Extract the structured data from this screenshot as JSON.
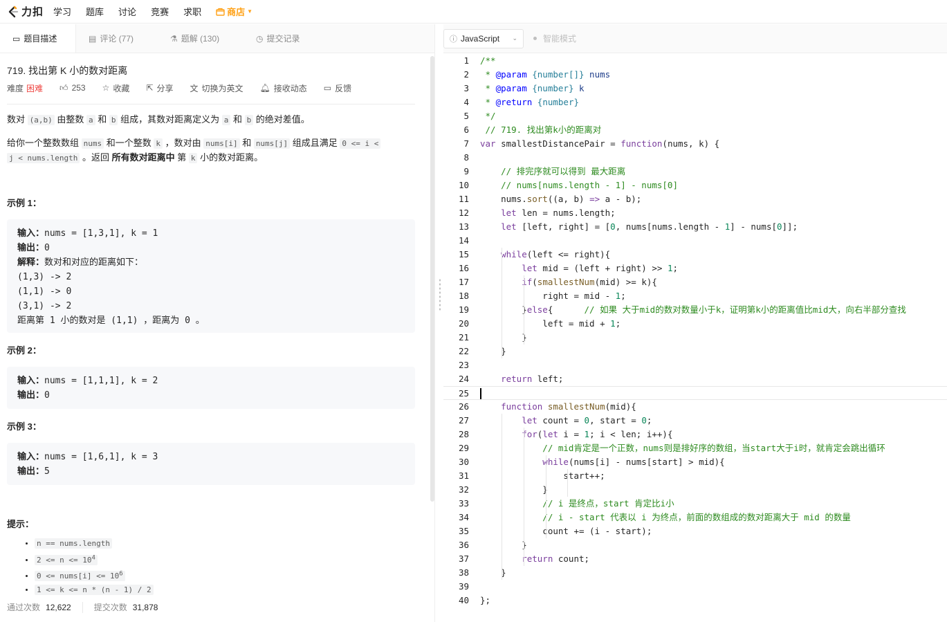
{
  "nav": {
    "logo_text": "力扣",
    "items": [
      "学习",
      "题库",
      "讨论",
      "竞赛",
      "求职"
    ],
    "store_label": "商店"
  },
  "tabs": [
    {
      "label": "题目描述",
      "icon": "description-icon"
    },
    {
      "label": "评论 (77)",
      "icon": "comment-icon"
    },
    {
      "label": "题解 (130)",
      "icon": "flask-icon"
    },
    {
      "label": "提交记录",
      "icon": "clock-icon"
    }
  ],
  "problem": {
    "title": "719. 找出第 K 小的数对距离",
    "difficulty_label": "难度",
    "difficulty": "困难",
    "likes": "253",
    "favorite": "收藏",
    "share": "分享",
    "switch_lang": "切换为英文",
    "subscribe": "接收动态",
    "feedback": "反馈",
    "p1_a": "数对 ",
    "p1_code1": "(a,b)",
    "p1_b": " 由整数 ",
    "p1_code2": "a",
    "p1_c": " 和 ",
    "p1_code3": "b",
    "p1_d": " 组成，其数对距离定义为 ",
    "p1_code4": "a",
    "p1_e": " 和 ",
    "p1_code5": "b",
    "p1_f": " 的绝对差值。",
    "p2_a": "给你一个整数数组 ",
    "p2_code1": "nums",
    "p2_b": " 和一个整数 ",
    "p2_code2": "k",
    "p2_c": " ，数对由 ",
    "p2_code3": "nums[i]",
    "p2_d": " 和 ",
    "p2_code4": "nums[j]",
    "p2_e": " 组成且满足 ",
    "p2_code5": "0 <= i <",
    "p2_code6": "j < nums.length",
    "p2_f": " 。返回 ",
    "p2_bold": "所有数对距离中",
    "p2_g": " 第 ",
    "p2_code7": "k",
    "p2_h": " 小的数对距离。"
  },
  "examples": [
    {
      "title": "示例 1：",
      "lines": [
        {
          "label": "输入：",
          "text": "nums = [1,3,1], k = 1"
        },
        {
          "label": "输出：",
          "text": "0"
        },
        {
          "label": "解释：",
          "text": "数对和对应的距离如下："
        },
        {
          "label": "",
          "text": "(1,3) -> 2"
        },
        {
          "label": "",
          "text": "(1,1) -> 0"
        },
        {
          "label": "",
          "text": "(3,1) -> 2"
        },
        {
          "label": "",
          "text": "距离第 1 小的数对是 (1,1) ，距离为 0 。"
        }
      ]
    },
    {
      "title": "示例 2：",
      "lines": [
        {
          "label": "输入：",
          "text": "nums = [1,1,1], k = 2"
        },
        {
          "label": "输出：",
          "text": "0"
        }
      ]
    },
    {
      "title": "示例 3：",
      "lines": [
        {
          "label": "输入：",
          "text": "nums = [1,6,1], k = 3"
        },
        {
          "label": "输出：",
          "text": "5"
        }
      ]
    }
  ],
  "tips": {
    "title": "提示：",
    "items": [
      {
        "base": "n == nums.length",
        "sup": ""
      },
      {
        "base": "2 <= n <= 10",
        "sup": "4"
      },
      {
        "base": "0 <= nums[i] <= 10",
        "sup": "6"
      },
      {
        "base": "1 <= k <= n * (n - 1) / 2",
        "sup": ""
      }
    ]
  },
  "stats": {
    "accepted_label": "通过次数",
    "accepted": "12,622",
    "submitted_label": "提交次数",
    "submitted": "31,878"
  },
  "editor": {
    "language": "JavaScript",
    "smart_mode": "智能模式",
    "current_line": 25,
    "lines": [
      [
        [
          "cm",
          "/**"
        ]
      ],
      [
        [
          "cm",
          " * "
        ],
        [
          "jd",
          "@param"
        ],
        [
          "jt",
          " {number[]}"
        ],
        [
          "pr",
          " nums"
        ]
      ],
      [
        [
          "cm",
          " * "
        ],
        [
          "jd",
          "@param"
        ],
        [
          "jt",
          " {number}"
        ],
        [
          "pr",
          " k"
        ]
      ],
      [
        [
          "cm",
          " * "
        ],
        [
          "jd",
          "@return"
        ],
        [
          "jt",
          " {number}"
        ]
      ],
      [
        [
          "cm",
          " */"
        ]
      ],
      [
        [
          "cm",
          " // 719. 找出第k小的距离对"
        ]
      ],
      [
        [
          "kw",
          "var"
        ],
        [
          "",
          " smallestDistancePair = "
        ],
        [
          "kw",
          "function"
        ],
        [
          "",
          "(nums, k) {"
        ]
      ],
      [
        [
          "",
          ""
        ]
      ],
      [
        [
          "cm",
          "    // 排完序就可以得到 最大距离"
        ]
      ],
      [
        [
          "cm",
          "    // nums[nums.length - 1] - nums[0]"
        ]
      ],
      [
        [
          "",
          "    nums."
        ],
        [
          "fn",
          "sort"
        ],
        [
          "",
          "((a, b) "
        ],
        [
          "kw",
          "=>"
        ],
        [
          "",
          " a - b);"
        ]
      ],
      [
        [
          "kw",
          "    let"
        ],
        [
          "",
          " len = nums.length;"
        ]
      ],
      [
        [
          "kw",
          "    let"
        ],
        [
          "",
          " [left, right] = ["
        ],
        [
          "num",
          "0"
        ],
        [
          "",
          ", nums[nums.length - "
        ],
        [
          "num",
          "1"
        ],
        [
          "",
          "] - nums["
        ],
        [
          "num",
          "0"
        ],
        [
          "",
          "]];"
        ]
      ],
      [
        [
          "",
          ""
        ]
      ],
      [
        [
          "kw",
          "    while"
        ],
        [
          "",
          "(left <= right){"
        ]
      ],
      [
        [
          "kw",
          "        let"
        ],
        [
          "",
          " mid = (left + right) >> "
        ],
        [
          "num",
          "1"
        ],
        [
          "",
          ";"
        ]
      ],
      [
        [
          "kw",
          "        if"
        ],
        [
          "",
          "("
        ],
        [
          "fn",
          "smallestNum"
        ],
        [
          "",
          "(mid) >= k){"
        ]
      ],
      [
        [
          "",
          "            right = mid - "
        ],
        [
          "num",
          "1"
        ],
        [
          "",
          ";"
        ]
      ],
      [
        [
          "",
          "        }"
        ],
        [
          "kw",
          "else"
        ],
        [
          "",
          "{      "
        ],
        [
          "cm",
          "// 如果 大于mid的数对数量小于k，证明第k小的距离值比mid大，向右半部分查找"
        ]
      ],
      [
        [
          "",
          "            left = mid + "
        ],
        [
          "num",
          "1"
        ],
        [
          "",
          ";"
        ]
      ],
      [
        [
          "",
          "        }"
        ]
      ],
      [
        [
          "",
          "    }"
        ]
      ],
      [
        [
          "",
          ""
        ]
      ],
      [
        [
          "kw",
          "    return"
        ],
        [
          "",
          " left;"
        ]
      ],
      [
        [
          "",
          ""
        ]
      ],
      [
        [
          "kw",
          "    function"
        ],
        [
          "fn",
          " smallestNum"
        ],
        [
          "",
          "(mid){"
        ]
      ],
      [
        [
          "kw",
          "        let"
        ],
        [
          "",
          " count = "
        ],
        [
          "num",
          "0"
        ],
        [
          "",
          ", start = "
        ],
        [
          "num",
          "0"
        ],
        [
          "",
          ";"
        ]
      ],
      [
        [
          "kw",
          "        for"
        ],
        [
          "",
          "("
        ],
        [
          "kw",
          "let"
        ],
        [
          "",
          " i = "
        ],
        [
          "num",
          "1"
        ],
        [
          "",
          "; i < len; i++){"
        ]
      ],
      [
        [
          "cm",
          "            // mid肯定是一个正数，nums则是排好序的数组，当start大于i时，就肯定会跳出循环"
        ]
      ],
      [
        [
          "kw",
          "            while"
        ],
        [
          "",
          "(nums[i] - nums[start] > mid){"
        ]
      ],
      [
        [
          "",
          "                start++;"
        ]
      ],
      [
        [
          "",
          "            }"
        ]
      ],
      [
        [
          "cm",
          "            // i 是终点，start 肯定比i小"
        ]
      ],
      [
        [
          "cm",
          "            // i - start 代表以 i 为终点，前面的数组成的数对距离大于 mid 的数量"
        ]
      ],
      [
        [
          "",
          "            count += (i - start);"
        ]
      ],
      [
        [
          "",
          "        }"
        ]
      ],
      [
        [
          "kw",
          "        return"
        ],
        [
          "",
          " count;"
        ]
      ],
      [
        [
          "",
          "    }"
        ]
      ],
      [
        [
          "",
          ""
        ]
      ],
      [
        [
          "",
          "};"
        ]
      ]
    ]
  }
}
